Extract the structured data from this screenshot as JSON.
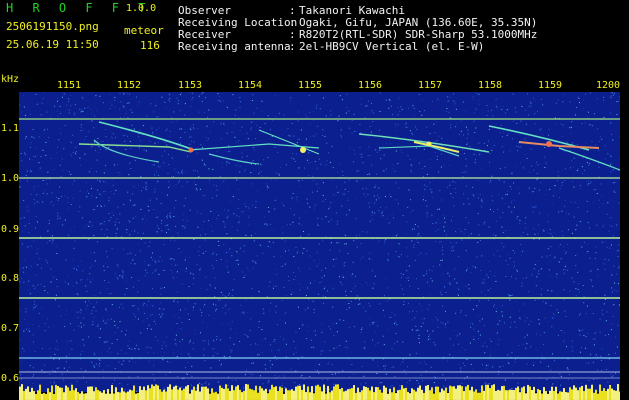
{
  "header": {
    "app_title": "H R O F F T",
    "version": "1.0.0",
    "file_name": "2506191150.png",
    "datetime": "25.06.19 11:50",
    "event_type": "meteor",
    "event_count": "116"
  },
  "info": [
    {
      "label": "Observer",
      "value": "Takanori Kawachi"
    },
    {
      "label": "Receiving Location",
      "value": "Ogaki, Gifu, JAPAN (136.60E, 35.35N)"
    },
    {
      "label": "Receiver",
      "value": "R820T2(RTL-SDR) SDR-Sharp 53.1000MHz"
    },
    {
      "label": "Receiving antenna",
      "value": "2el-HB9CV Vertical (el. E-W)"
    }
  ],
  "separator": ":",
  "axis": {
    "unit": "kHz",
    "time_ticks": [
      "1151",
      "1152",
      "1153",
      "1154",
      "1155",
      "1156",
      "1157",
      "1158",
      "1159",
      "1200"
    ],
    "freq_ticks": [
      "1.1",
      "1.0",
      "0.9",
      "0.8",
      "0.7",
      "0.6"
    ]
  },
  "colors": {
    "background": "#0c1f8e",
    "text_green": "#1fd41f",
    "text_yellow": "#f0f020",
    "text_white": "#f2f2f2"
  }
}
